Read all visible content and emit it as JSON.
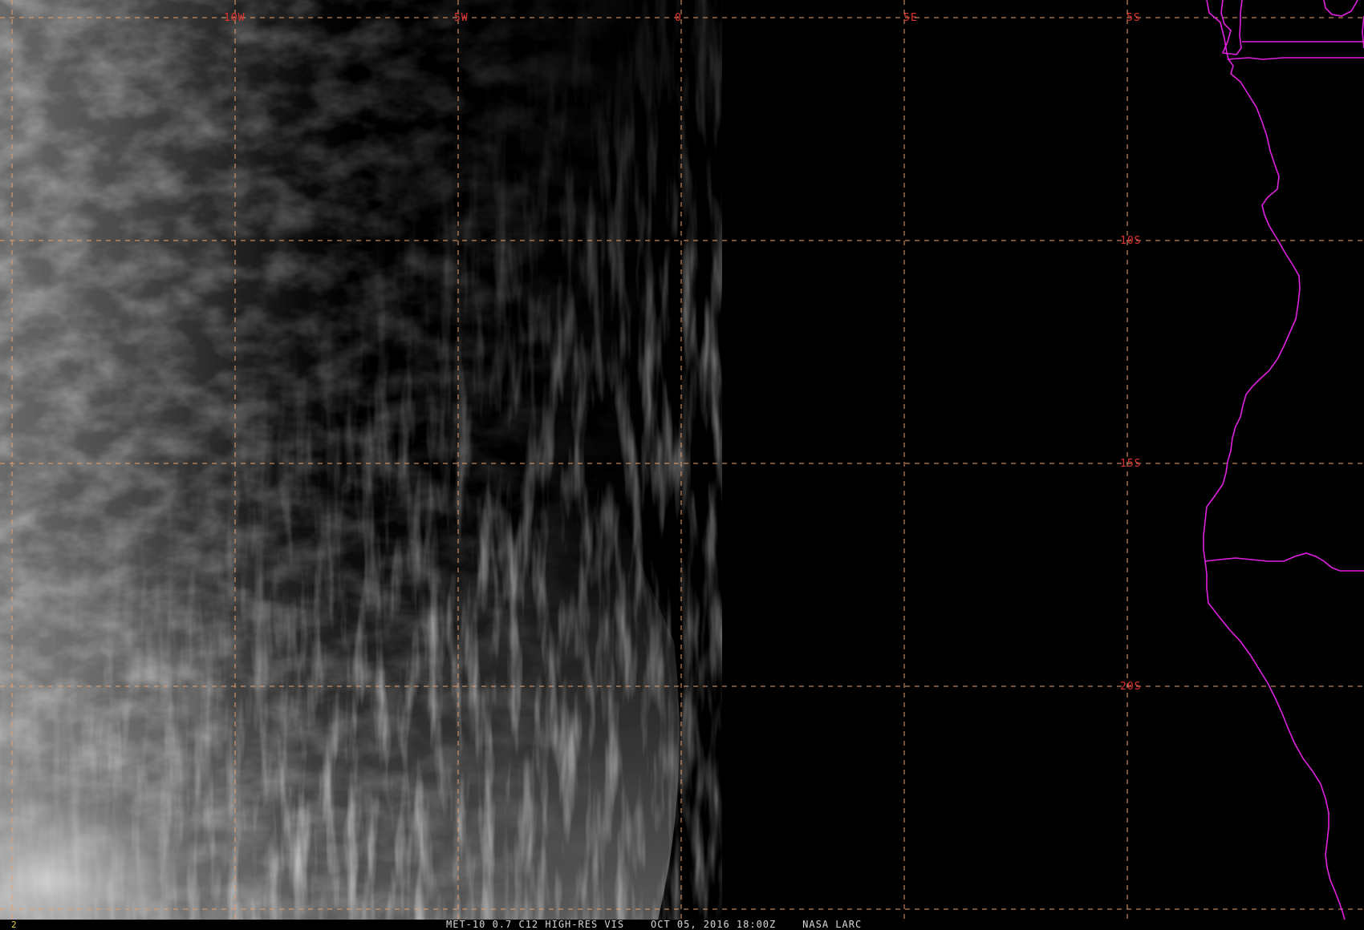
{
  "image": {
    "sensor_caption": "MET-10 0.7 C12 HIGH-RES VIS",
    "datetime": "OCT 05, 2016 18:00Z",
    "source": "NASA LARC",
    "frame_number": "2"
  },
  "grid": {
    "longitude_labels": [
      "10W",
      "5W",
      "0",
      "5E"
    ],
    "latitude_labels": [
      "5S",
      "10S",
      "15S",
      "20S"
    ]
  },
  "colors": {
    "background": "#000000",
    "grid_lines": "#e8a070",
    "grid_labels": "#e03030",
    "coastline": "#e020e0",
    "caption_text": "#d8d8d8",
    "frame_number": "#e8d040"
  },
  "layers": [
    "visible-satellite-imagery",
    "lat-lon-grid",
    "coastline-and-borders"
  ]
}
